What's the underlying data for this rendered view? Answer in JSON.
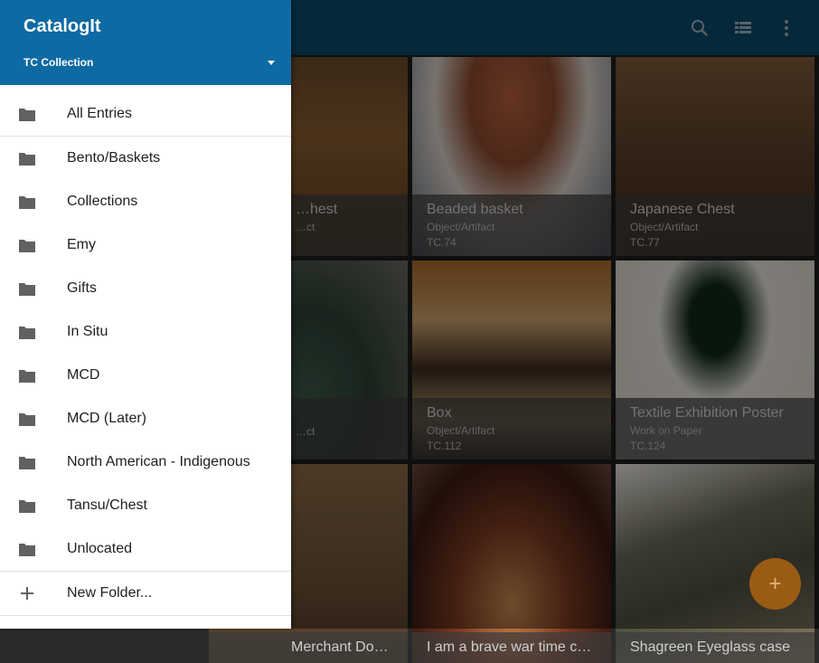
{
  "app": {
    "title": "CatalogIt"
  },
  "collection": {
    "name": "TC Collection"
  },
  "toolbar": {
    "search_icon": "search-icon",
    "view_icon": "list-view-icon",
    "more_icon": "more-vert-icon"
  },
  "drawer": {
    "all_entries": "All Entries",
    "folders": [
      "Bento/Baskets",
      "Collections",
      "Emy",
      "Gifts",
      "In Situ",
      "MCD",
      "MCD (Later)",
      "North American - Indigenous",
      "Tansu/Chest",
      "Unlocated"
    ],
    "new_folder": "New Folder..."
  },
  "grid": {
    "tiles": [
      {
        "title": "…hest",
        "subtitle": "…ct",
        "code": ""
      },
      {
        "title": "Beaded basket",
        "subtitle": "Object/Artifact",
        "code": "TC.74"
      },
      {
        "title": "Japanese Chest",
        "subtitle": "Object/Artifact",
        "code": "TC.77"
      },
      {
        "title": "",
        "subtitle": "…ct",
        "code": ""
      },
      {
        "title": "Box",
        "subtitle": "Object/Artifact",
        "code": "TC.112"
      },
      {
        "title": "Textile Exhibition Poster",
        "subtitle": "Work on Paper",
        "code": "TC.124"
      },
      {
        "title": "Merchant Docu…",
        "subtitle": "",
        "code": ""
      },
      {
        "title": "I am a brave war time chic…",
        "subtitle": "",
        "code": ""
      },
      {
        "title": "Shagreen Eyeglass case",
        "subtitle": "",
        "code": ""
      }
    ]
  },
  "fab": {
    "label": "+"
  },
  "colors": {
    "appbar": "#0b4a6c",
    "drawer_header": "#0e6aa2",
    "fab": "#9a5b14"
  }
}
